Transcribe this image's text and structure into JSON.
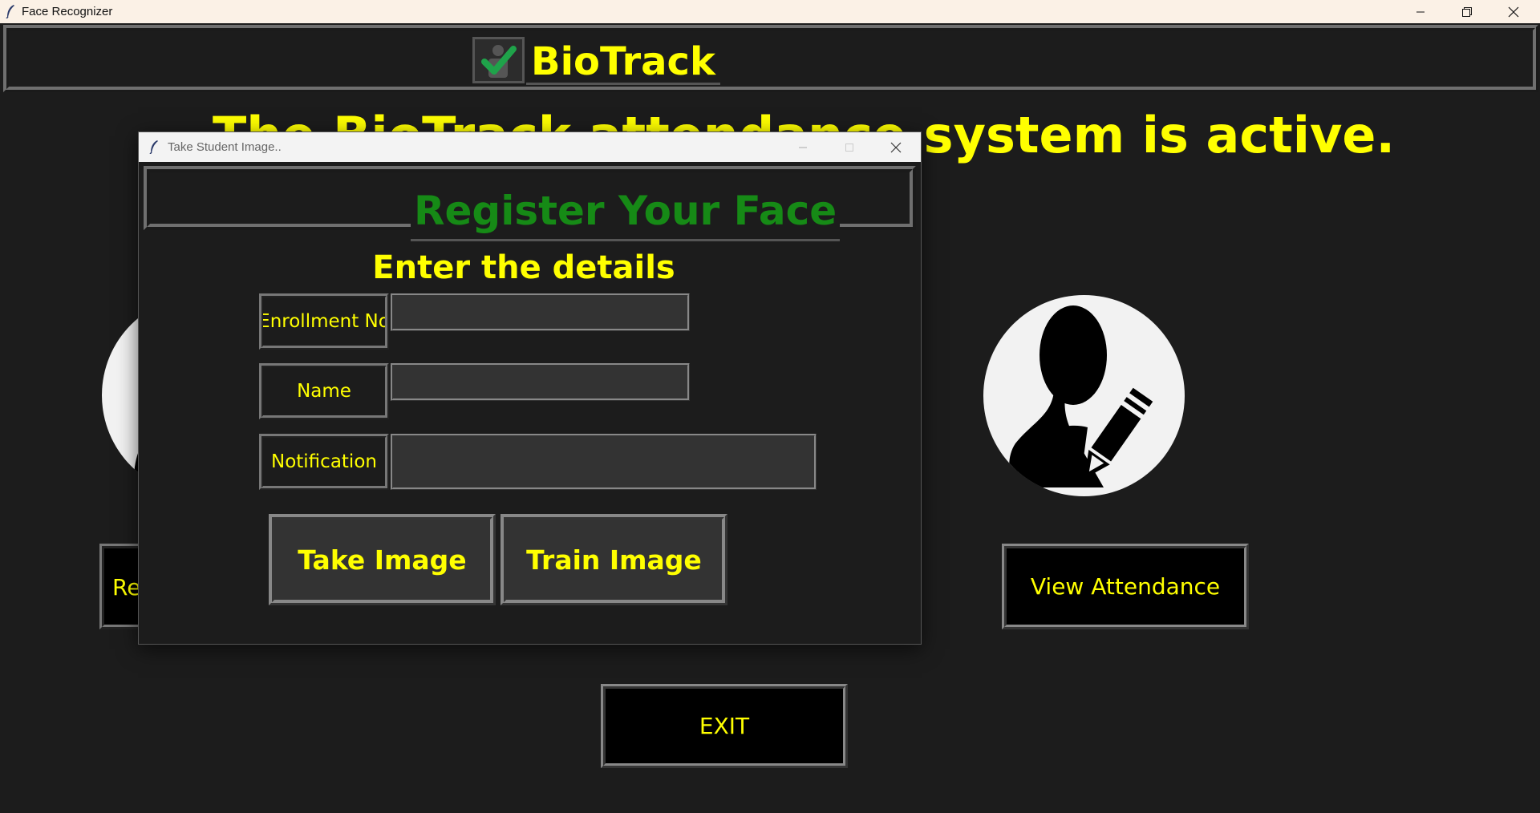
{
  "main_window": {
    "title": "Face Recognizer",
    "brand": "BioTrack",
    "banner": "The BioTrack attendance system is active.",
    "left_button_partial": "Re",
    "view_attendance_label": "View Attendance",
    "exit_label": "EXIT"
  },
  "dialog": {
    "title": "Take Student Image..",
    "heading": "Register Your Face",
    "subheading": "Enter the details",
    "fields": {
      "enrollment_label": "Enrollment No",
      "enrollment_value": "",
      "name_label": "Name",
      "name_value": "",
      "notification_label": "Notification",
      "notification_value": ""
    },
    "take_image_label": "Take Image",
    "train_image_label": "Train Image"
  },
  "colors": {
    "background": "#1c1c1c",
    "accent_text": "#ffff00",
    "heading_green": "#168a16"
  }
}
